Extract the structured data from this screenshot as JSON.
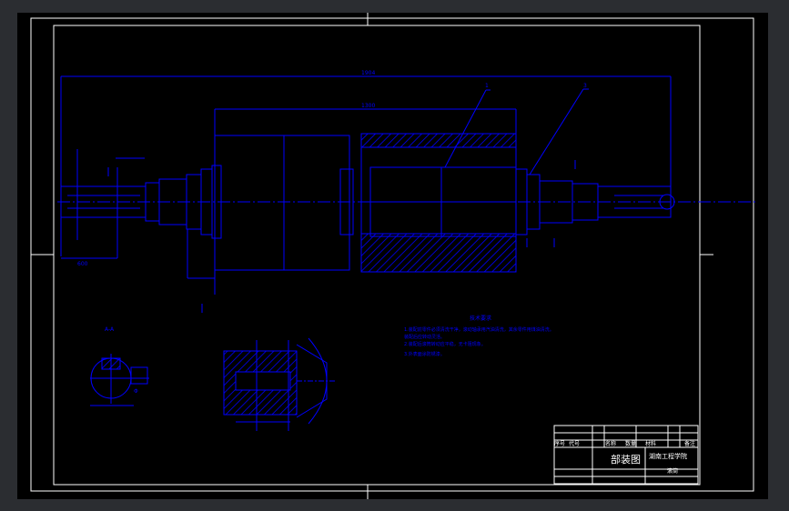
{
  "drawing": {
    "overall_length": "1904",
    "middle_length": "1300",
    "sheet_length_left": "600",
    "sheet_length_right": "",
    "leader_1": "1",
    "leader_2": "3",
    "section_label": "A-A",
    "dim_phi": "Φ",
    "notes_title": "技术要求",
    "notes": [
      "1.装配前零件必须清洗干净，滚动轴承用汽油清洗，其余零件用煤油清洗。",
      "  装配后应转动灵活。",
      "2.装配后滚筒转动应平稳，无卡阻现象。",
      "3.外表面涂防锈漆。"
    ]
  },
  "title_block": {
    "drawing_name": "部装图",
    "school": "湖南工程学院",
    "part_name": "滚筒",
    "headers": [
      "序号",
      "代号",
      "名称",
      "数量",
      "材料",
      "备注"
    ]
  }
}
